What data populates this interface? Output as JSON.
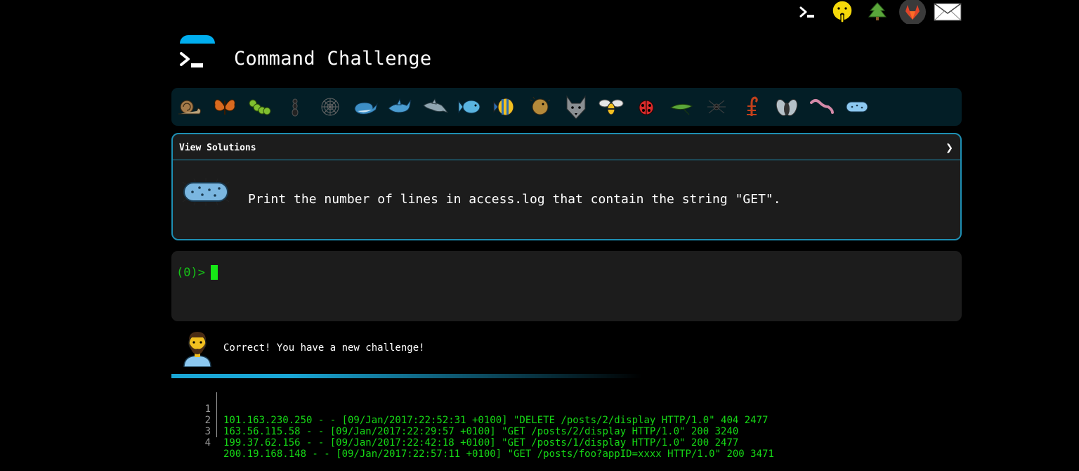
{
  "header": {
    "title": "Command Challenge"
  },
  "top_icons": [
    "terminal-icon",
    "shushing-face-icon",
    "tree-icon",
    "gitlab-fox-icon",
    "envelope-icon"
  ],
  "animals": [
    "snail-icon",
    "butterfly-icon",
    "caterpillar-icon",
    "ant-icon",
    "spider-web-icon",
    "whale-icon",
    "shark-icon",
    "dolphin-icon",
    "fish-icon",
    "tropical-fish-icon",
    "blowfish-icon",
    "wolf-icon",
    "bee-icon",
    "ladybug-icon",
    "cricket-icon",
    "spider-icon",
    "scorpion-icon",
    "fly-icon",
    "worm-icon",
    "microbe-icon"
  ],
  "solutions": {
    "title": "View Solutions",
    "chevron": "❯"
  },
  "challenge": {
    "text": "Print the number of lines in access.log that contain the string \"GET\"."
  },
  "terminal": {
    "prompt": "(0)>"
  },
  "message": {
    "text": "Correct! You have a new challenge!"
  },
  "log": [
    {
      "n": "1",
      "text": "101.163.230.250 - - [09/Jan/2017:22:52:31 +0100] \"DELETE /posts/2/display HTTP/1.0\" 404 2477"
    },
    {
      "n": "2",
      "text": "163.56.115.58 - - [09/Jan/2017:22:29:57 +0100] \"GET /posts/2/display HTTP/1.0\" 200 3240"
    },
    {
      "n": "3",
      "text": "199.37.62.156 - - [09/Jan/2017:22:42:18 +0100] \"GET /posts/1/display HTTP/1.0\" 200 2477"
    },
    {
      "n": "4",
      "text": "200.19.168.148 - - [09/Jan/2017:22:57:11 +0100] \"GET /posts/foo?appID=xxxx HTTP/1.0\" 200 3471"
    }
  ],
  "colors": {
    "accent": "#1e8fb3",
    "prompt_green": "#16c216",
    "log_green": "#16d916",
    "panel_bg": "#1c1c1c",
    "strip_bg": "#031e26"
  }
}
